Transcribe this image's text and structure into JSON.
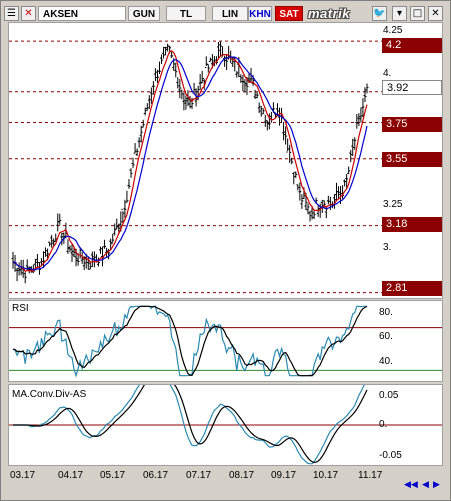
{
  "toolbar": {
    "symbol": "AKSEN",
    "btn_gun": "GUN",
    "btn_tl": "TL",
    "btn_lin": "LIN",
    "btn_khn": "KHN",
    "btn_sat": "SAT",
    "logo": "matrik",
    "icons": [
      "list-icon",
      "close-x-icon",
      "twitter-icon",
      "chevron-down-icon",
      "maximize-icon",
      "close-icon"
    ]
  },
  "main_chart": {
    "price_levels": [
      "4.2",
      "3.75",
      "3.55",
      "3.18",
      "2.81"
    ],
    "current_price": "3.92",
    "axis_labels": [
      "4.25",
      "4.",
      "3.25",
      "3."
    ]
  },
  "rsi": {
    "title": "RSI",
    "axis_labels": [
      "80.",
      "60.",
      "40."
    ]
  },
  "macd": {
    "title": "MA.Conv.Div-AS",
    "axis_labels": [
      "0.05",
      "0.",
      "-0.05"
    ]
  },
  "months": [
    "03.17",
    "04.17",
    "05.17",
    "06.17",
    "07.17",
    "08.17",
    "09.17",
    "10.17",
    "11.17"
  ],
  "colors": {
    "level_tag": "#8b0000",
    "sat": "#d40000",
    "price_line": "#000000",
    "ma1": "#cc0000",
    "ma2": "#0000cc",
    "rsi_line": "#000000",
    "rsi_line2": "#2a8ab0"
  }
}
